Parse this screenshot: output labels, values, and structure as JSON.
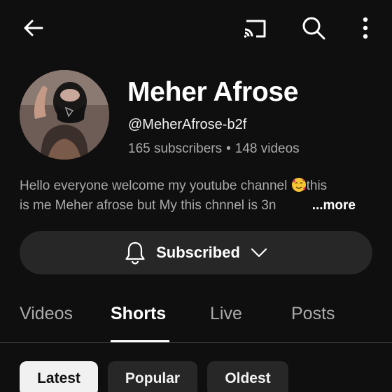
{
  "topbar": {
    "icons": [
      "back-arrow-icon",
      "cast-icon",
      "search-icon",
      "more-vert-icon"
    ]
  },
  "channel": {
    "name": "Meher Afrose",
    "handle": "@MeherAfrose-b2f",
    "subscribers": "165 subscribers",
    "separator": "•",
    "videos": "148 videos"
  },
  "description": {
    "line1": "Hello everyone welcome my youtube channel",
    "line1_end": "this",
    "line2": "is me Meher afrose but My this chnnel is 3n",
    "more_label": "...more",
    "emoji": "smiling-face-with-hearts"
  },
  "subscribe_button": {
    "label": "Subscribed",
    "bell_icon": "bell-icon",
    "chevron_icon": "chevron-down-icon"
  },
  "tabs": [
    {
      "label": "Videos",
      "active": false
    },
    {
      "label": "Shorts",
      "active": true
    },
    {
      "label": "Live",
      "active": false
    },
    {
      "label": "Posts",
      "active": false
    }
  ],
  "chips": [
    {
      "label": "Latest",
      "selected": true
    },
    {
      "label": "Popular",
      "selected": false
    },
    {
      "label": "Oldest",
      "selected": false
    }
  ],
  "colors": {
    "background": "#0f0f0f",
    "button_bg": "#272727",
    "text_primary": "#ffffff",
    "text_secondary": "#aaaaaa"
  }
}
